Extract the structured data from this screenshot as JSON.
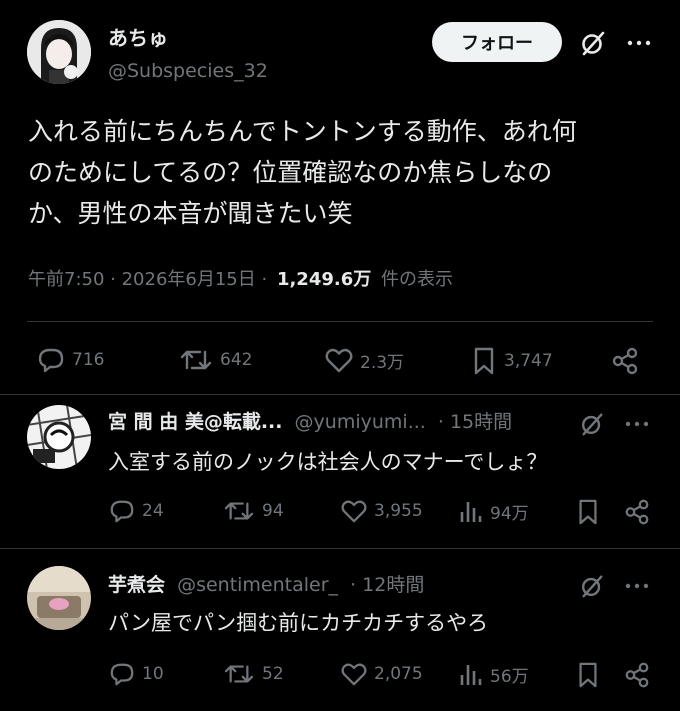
{
  "main_post": {
    "display_name": "あちゅ",
    "handle": "@Subspecies_32",
    "follow_label": "フォロー",
    "text_lines": [
      "入れる前にちんちんでトントンする動作、あれ何",
      "のためにしてるの？位置確認なのか焦らしなの",
      "か、男性の本音が聞きたい笑"
    ],
    "timestamp": "午前7:50 · 2026年6月15日 ·",
    "views_count": "1,249.6万",
    "views_label": "件の表示",
    "stats": {
      "replies": "716",
      "reposts": "642",
      "likes": "2.3万",
      "bookmarks": "3,747"
    }
  },
  "replies": [
    {
      "display_name": "宮 間 由 美@転載...",
      "handle": "@yumiyumi...",
      "time": "· 15時間",
      "text": "入室する前のノックは社会人のマナーでしょ？",
      "replies": "24",
      "reposts": "94",
      "likes": "3,955",
      "views": "94万"
    },
    {
      "display_name": "芋煮会",
      "handle": "@sentimentaler_",
      "time": "· 12時間",
      "text": "パン屋でパン掴む前にカチカチするやろ",
      "replies": "10",
      "reposts": "52",
      "likes": "2,075",
      "views": "56万"
    }
  ],
  "colors": {
    "background": "#000000",
    "text": "#e7e9ea",
    "muted": "#71767b",
    "divider": "#2f3336",
    "follow_bg": "#eff3f4"
  },
  "icons": [
    "grok-icon",
    "more-icon",
    "reply-icon",
    "repost-icon",
    "like-icon",
    "bookmark-icon",
    "share-icon",
    "views-icon"
  ]
}
